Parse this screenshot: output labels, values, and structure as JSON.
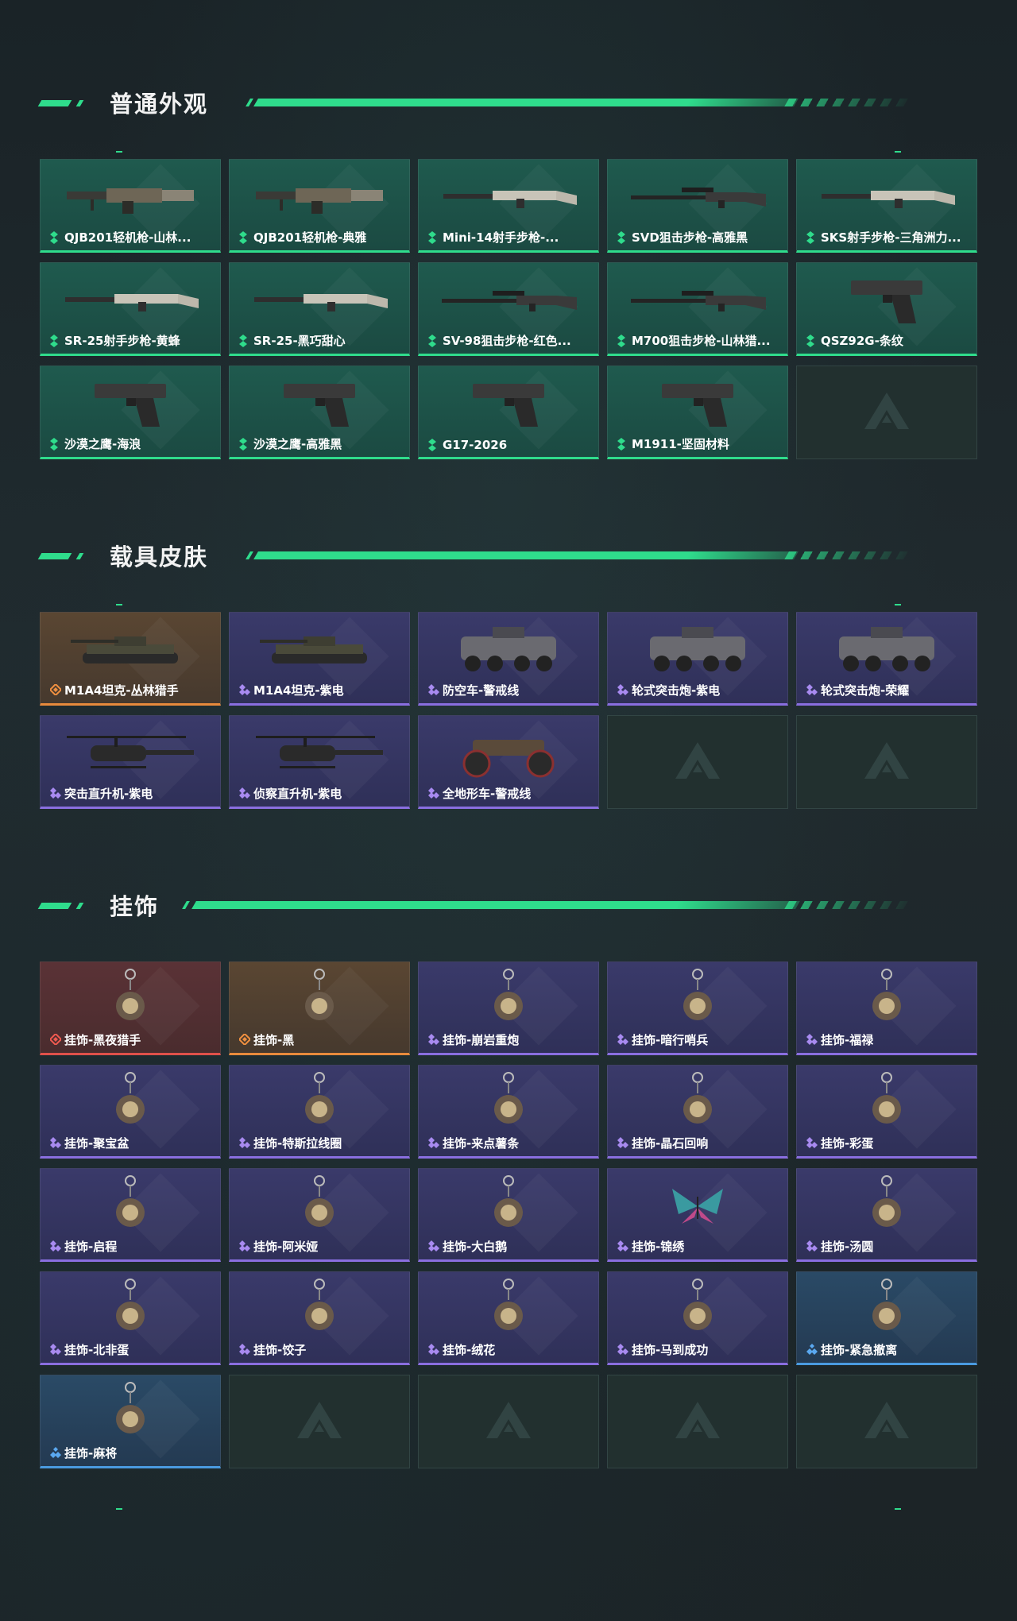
{
  "sections": [
    {
      "title": "普通外观",
      "items": [
        {
          "label": "QJB201轻机枪-山林...",
          "rarity": "green",
          "icon": "lmg-icon"
        },
        {
          "label": "QJB201轻机枪-典雅",
          "rarity": "green",
          "icon": "lmg-icon"
        },
        {
          "label": "Mini-14射手步枪-...",
          "rarity": "green",
          "icon": "rifle-icon"
        },
        {
          "label": "SVD狙击步枪-高雅黑",
          "rarity": "green",
          "icon": "sniper-icon"
        },
        {
          "label": "SKS射手步枪-三角洲力...",
          "rarity": "green",
          "icon": "rifle-icon"
        },
        {
          "label": "SR-25射手步枪-黄蜂",
          "rarity": "green",
          "icon": "rifle-icon"
        },
        {
          "label": "SR-25-黑巧甜心",
          "rarity": "green",
          "icon": "rifle-icon"
        },
        {
          "label": "SV-98狙击步枪-红色...",
          "rarity": "green",
          "icon": "sniper-icon"
        },
        {
          "label": "M700狙击步枪-山林猎...",
          "rarity": "green",
          "icon": "sniper-icon"
        },
        {
          "label": "QSZ92G-条纹",
          "rarity": "green",
          "icon": "pistol-icon"
        },
        {
          "label": "沙漠之鹰-海浪",
          "rarity": "green",
          "icon": "pistol-icon"
        },
        {
          "label": "沙漠之鹰-高雅黑",
          "rarity": "green",
          "icon": "pistol-icon"
        },
        {
          "label": "G17-2026",
          "rarity": "green",
          "icon": "pistol-icon"
        },
        {
          "label": "M1911-坚固材料",
          "rarity": "green",
          "icon": "pistol-icon"
        },
        {
          "label": "",
          "rarity": "empty",
          "icon": "placeholder-logo-icon"
        }
      ]
    },
    {
      "title": "载具皮肤",
      "items": [
        {
          "label": "M1A4坦克-丛林猎手",
          "rarity": "orange",
          "icon": "tank-icon"
        },
        {
          "label": "M1A4坦克-紫电",
          "rarity": "purple",
          "icon": "tank-icon"
        },
        {
          "label": "防空车-警戒线",
          "rarity": "purple",
          "icon": "armored-vehicle-icon"
        },
        {
          "label": "轮式突击炮-紫电",
          "rarity": "purple",
          "icon": "armored-vehicle-icon"
        },
        {
          "label": "轮式突击炮-荣耀",
          "rarity": "purple",
          "icon": "armored-vehicle-icon"
        },
        {
          "label": "突击直升机-紫电",
          "rarity": "purple",
          "icon": "helicopter-icon"
        },
        {
          "label": "侦察直升机-紫电",
          "rarity": "purple",
          "icon": "helicopter-icon"
        },
        {
          "label": "全地形车-警戒线",
          "rarity": "purple",
          "icon": "atv-icon"
        },
        {
          "label": "",
          "rarity": "empty",
          "icon": "placeholder-logo-icon"
        },
        {
          "label": "",
          "rarity": "empty",
          "icon": "placeholder-logo-icon"
        }
      ]
    },
    {
      "title": "挂饰",
      "items": [
        {
          "label": "挂饰-黑夜猎手",
          "rarity": "red",
          "icon": "charm-icon"
        },
        {
          "label": "挂饰-黑",
          "rarity": "orange",
          "icon": "charm-icon"
        },
        {
          "label": "挂饰-崩岩重炮",
          "rarity": "purple",
          "icon": "charm-icon"
        },
        {
          "label": "挂饰-暗行哨兵",
          "rarity": "purple",
          "icon": "charm-icon"
        },
        {
          "label": "挂饰-福禄",
          "rarity": "purple",
          "icon": "charm-icon"
        },
        {
          "label": "挂饰-聚宝盆",
          "rarity": "purple",
          "icon": "charm-icon"
        },
        {
          "label": "挂饰-特斯拉线圈",
          "rarity": "purple",
          "icon": "charm-icon"
        },
        {
          "label": "挂饰-来点薯条",
          "rarity": "purple",
          "icon": "charm-icon"
        },
        {
          "label": "挂饰-晶石回响",
          "rarity": "purple",
          "icon": "charm-icon"
        },
        {
          "label": "挂饰-彩蛋",
          "rarity": "purple",
          "icon": "charm-icon"
        },
        {
          "label": "挂饰-启程",
          "rarity": "purple",
          "icon": "charm-icon"
        },
        {
          "label": "挂饰-阿米娅",
          "rarity": "purple",
          "icon": "charm-icon"
        },
        {
          "label": "挂饰-大白鹅",
          "rarity": "purple",
          "icon": "charm-icon"
        },
        {
          "label": "挂饰-锦绣",
          "rarity": "purple",
          "icon": "butterfly-icon"
        },
        {
          "label": "挂饰-汤圆",
          "rarity": "purple",
          "icon": "charm-icon"
        },
        {
          "label": "挂饰-北非蛋",
          "rarity": "purple",
          "icon": "charm-icon"
        },
        {
          "label": "挂饰-饺子",
          "rarity": "purple",
          "icon": "charm-icon"
        },
        {
          "label": "挂饰-绒花",
          "rarity": "purple",
          "icon": "charm-icon"
        },
        {
          "label": "挂饰-马到成功",
          "rarity": "purple",
          "icon": "charm-icon"
        },
        {
          "label": "挂饰-紧急撤离",
          "rarity": "blue",
          "icon": "charm-icon"
        },
        {
          "label": "挂饰-麻将",
          "rarity": "blue",
          "icon": "charm-icon"
        },
        {
          "label": "",
          "rarity": "empty",
          "icon": "placeholder-logo-icon"
        },
        {
          "label": "",
          "rarity": "empty",
          "icon": "placeholder-logo-icon"
        },
        {
          "label": "",
          "rarity": "empty",
          "icon": "placeholder-logo-icon"
        },
        {
          "label": "",
          "rarity": "empty",
          "icon": "placeholder-logo-icon"
        }
      ]
    }
  ],
  "colors": {
    "accent": "#2fdc8c",
    "green": "#2fdc8c",
    "purple": "#8a6ee0",
    "orange": "#e88a3c",
    "red": "#e0504a",
    "blue": "#4a9ae0"
  }
}
